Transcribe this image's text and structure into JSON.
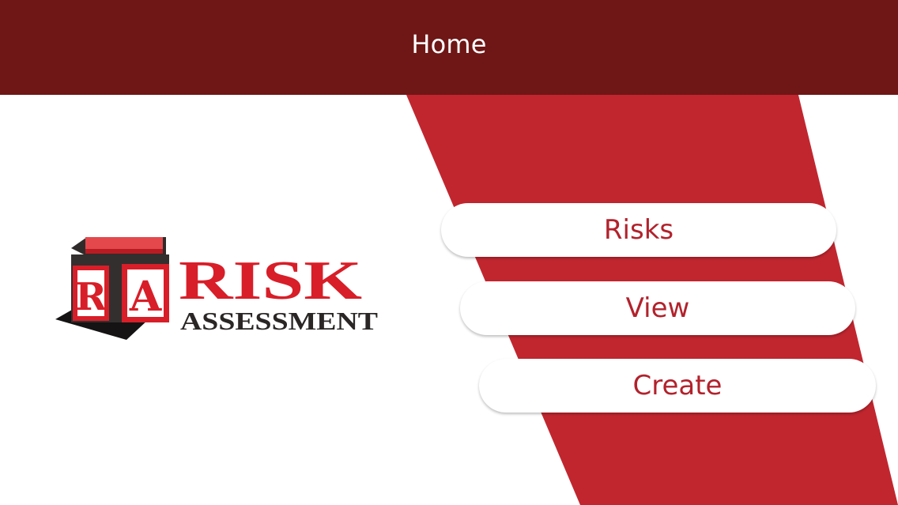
{
  "header": {
    "title": "Home"
  },
  "logo": {
    "cube_letters": [
      "R",
      "A"
    ],
    "word_main": "RISK",
    "word_sub": "ASSESSMENT"
  },
  "menu": {
    "risks_label": "Risks",
    "view_label": "View",
    "create_label": "Create"
  },
  "colors": {
    "header_bg": "#6e1716",
    "stripe_red": "#c1262f",
    "button_text": "#b2222c",
    "logo_red": "#d81e28",
    "logo_dark": "#2a2626"
  }
}
